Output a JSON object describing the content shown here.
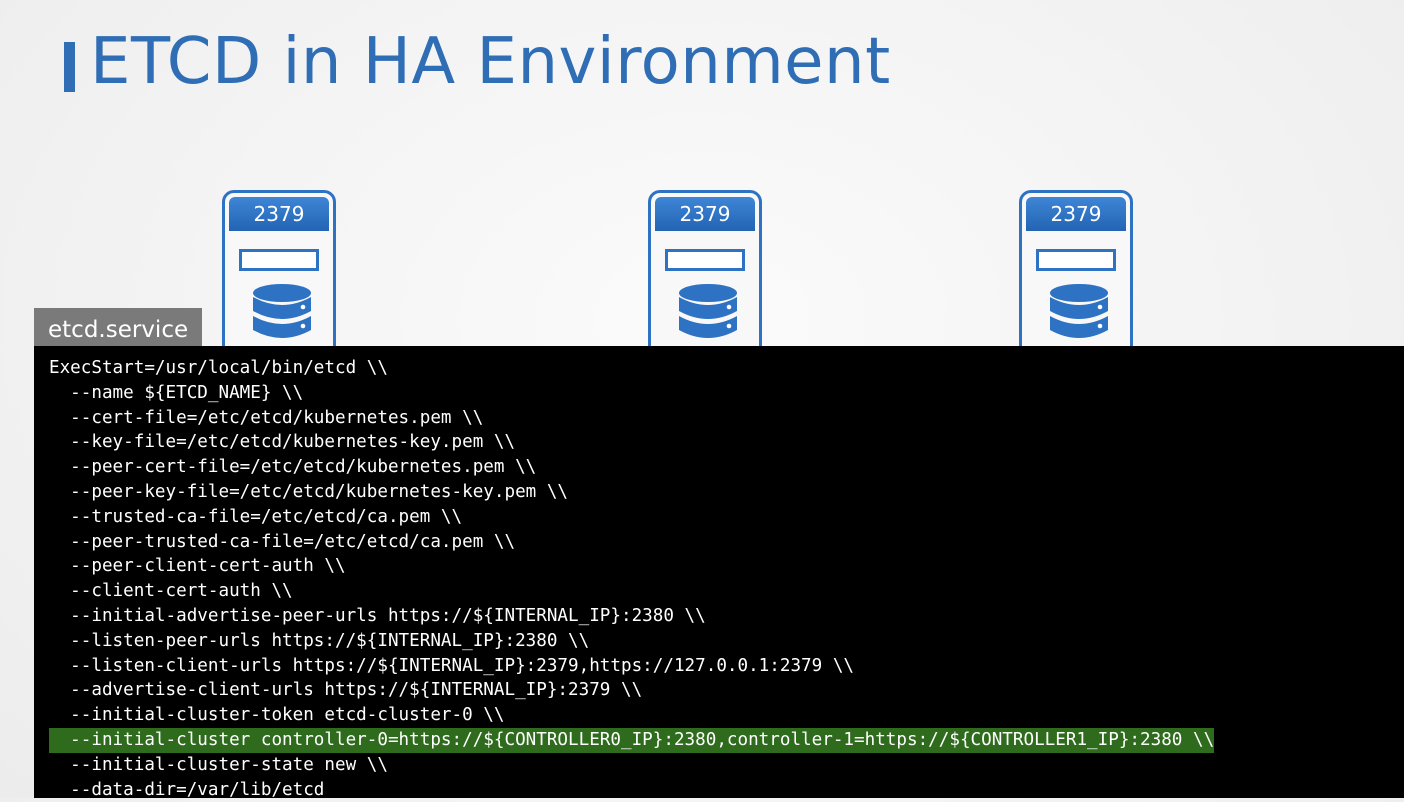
{
  "slide": {
    "title": "ETCD in HA Environment"
  },
  "servers": [
    {
      "port": "2379"
    },
    {
      "port": "2379"
    },
    {
      "port": "2379"
    }
  ],
  "file_tab": "etcd.service",
  "code_lines": [
    "ExecStart=/usr/local/bin/etcd \\\\",
    "  --name ${ETCD_NAME} \\\\",
    "  --cert-file=/etc/etcd/kubernetes.pem \\\\",
    "  --key-file=/etc/etcd/kubernetes-key.pem \\\\",
    "  --peer-cert-file=/etc/etcd/kubernetes.pem \\\\",
    "  --peer-key-file=/etc/etcd/kubernetes-key.pem \\\\",
    "  --trusted-ca-file=/etc/etcd/ca.pem \\\\",
    "  --peer-trusted-ca-file=/etc/etcd/ca.pem \\\\",
    "  --peer-client-cert-auth \\\\",
    "  --client-cert-auth \\\\",
    "  --initial-advertise-peer-urls https://${INTERNAL_IP}:2380 \\\\",
    "  --listen-peer-urls https://${INTERNAL_IP}:2380 \\\\",
    "  --listen-client-urls https://${INTERNAL_IP}:2379,https://127.0.0.1:2379 \\\\",
    "  --advertise-client-urls https://${INTERNAL_IP}:2379 \\\\",
    "  --initial-cluster-token etcd-cluster-0 \\\\",
    "  --initial-cluster controller-0=https://${CONTROLLER0_IP}:2380,controller-1=https://${CONTROLLER1_IP}:2380 \\\\",
    "  --initial-cluster-state new \\\\",
    "  --data-dir=/var/lib/etcd"
  ],
  "highlighted_line": 15,
  "colors": {
    "accent": "#2f6db5",
    "server_border": "#2e72c4",
    "code_bg": "#000000",
    "highlight": "#2e6b1c",
    "file_tab_bg": "#7a7a7a"
  },
  "icons": [
    "database-icon"
  ]
}
